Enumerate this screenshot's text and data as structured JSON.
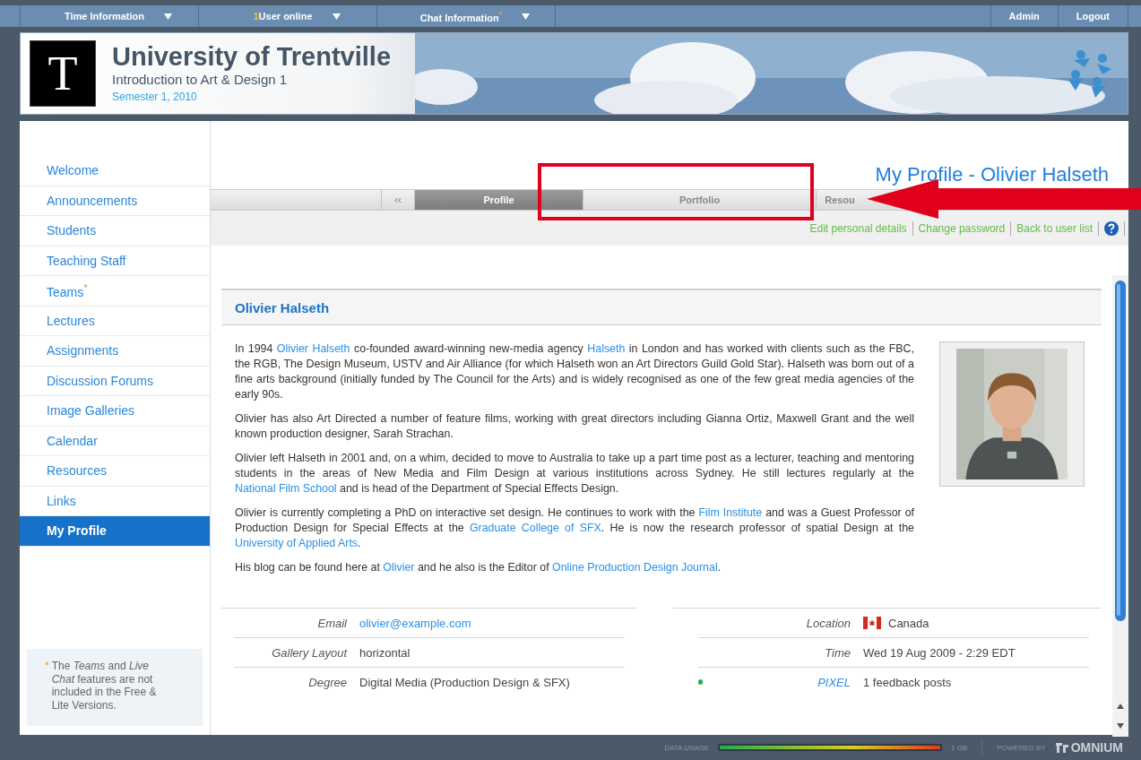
{
  "top_bar": {
    "menus": [
      {
        "label": "Time Information"
      },
      {
        "count": "1",
        "label": "User online"
      },
      {
        "label": "Chat Information",
        "mark": "*"
      }
    ],
    "buttons": [
      "Admin",
      "Logout"
    ]
  },
  "header": {
    "logo_letter": "T",
    "title": "University of Trentville",
    "subtitle": "Introduction to Art & Design 1",
    "semester": "Semester 1, 2010"
  },
  "sidebar": {
    "items": [
      {
        "label": "Welcome",
        "selected": false
      },
      {
        "label": "Announcements",
        "selected": false
      },
      {
        "label": "Students",
        "selected": false
      },
      {
        "label": "Teaching Staff",
        "selected": false
      },
      {
        "label": "Teams",
        "mark": "*",
        "selected": false
      },
      {
        "label": "Lectures",
        "selected": false
      },
      {
        "label": "Assignments",
        "selected": false
      },
      {
        "label": "Discussion Forums",
        "selected": false
      },
      {
        "label": "Image Galleries",
        "selected": false
      },
      {
        "label": "Calendar",
        "selected": false
      },
      {
        "label": "Resources",
        "selected": false
      },
      {
        "label": "Links",
        "selected": false
      },
      {
        "label": "My Profile",
        "selected": true
      }
    ],
    "note": {
      "mark": "*",
      "text": "The *Teams* and *Live Chat* features are not included in the Free & Lite Versions."
    }
  },
  "page_title": "My Profile - Olivier Halseth",
  "tabs": {
    "previous": "‹‹",
    "items": [
      {
        "label": "Profile",
        "selected": true
      },
      {
        "label": "Portfolio",
        "selected": false
      },
      {
        "label": "Resou",
        "selected": false
      }
    ]
  },
  "actions": [
    "Edit personal details",
    "Change password",
    "Back to user list"
  ],
  "profile": {
    "name": "Olivier Halseth",
    "paragraphs": [
      [
        {
          "text": "In 1994 ",
          "kind": "text"
        },
        {
          "text": "Olivier Halseth",
          "kind": "link"
        },
        {
          "text": " co-founded award-winning new-media agency ",
          "kind": "text"
        },
        {
          "text": "Halseth",
          "kind": "link"
        },
        {
          "text": " in London and has worked with clients such as the FBC, the RGB, The Design Museum, USTV and Air Alliance (for which Halseth won an Art Directors Guild Gold Star). Halseth was born out of a fine arts background (initially funded by The Council for the Arts) and is widely recognised as one of the few great media agencies of the early 90s.",
          "kind": "text"
        }
      ],
      [
        {
          "text": "Olivier has also Art Directed a number of feature films, working with great directors including Gianna Ortiz, Maxwell Grant and the well known production designer, Sarah Strachan.",
          "kind": "text"
        }
      ],
      [
        {
          "text": "Olivier left Halseth in 2001 and, on a whim, decided to move to Australia to take up a part time post as a lecturer, teaching and mentoring students in the areas of New Media and Film Design at various institutions across Sydney. He still lectures regularly at the ",
          "kind": "text"
        },
        {
          "text": "National Film School",
          "kind": "link"
        },
        {
          "text": " and is head of the Department of Special Effects Design.",
          "kind": "text"
        }
      ],
      [
        {
          "text": "Olivier is currently completing a PhD on interactive set design. He continues to work with the ",
          "kind": "text"
        },
        {
          "text": "Film Institute",
          "kind": "link"
        },
        {
          "text": " and was a Guest Professor of Production Design for Special Effects at the ",
          "kind": "text"
        },
        {
          "text": "Graduate College of SFX",
          "kind": "link"
        },
        {
          "text": ". He is now the research professor of spatial Design at the ",
          "kind": "text"
        },
        {
          "text": "University of Applied Arts",
          "kind": "link"
        },
        {
          "text": ".",
          "kind": "text"
        }
      ],
      [
        {
          "text": "His blog can be found here at ",
          "kind": "text"
        },
        {
          "text": "Olivier",
          "kind": "link"
        },
        {
          "text": " and he also is the Editor of ",
          "kind": "text"
        },
        {
          "text": "Online Production Design Journal",
          "kind": "link"
        },
        {
          "text": ".",
          "kind": "text"
        }
      ]
    ],
    "photo": {
      "kind": "picture"
    },
    "fields_left": [
      {
        "label": "Email",
        "value": "olivier@example.com",
        "kind": "link"
      },
      {
        "label": "Gallery Layout",
        "value": "horizontal",
        "kind": "text"
      },
      {
        "label": "Degree",
        "value": "Digital Media (Production Design & SFX)",
        "kind": "text"
      }
    ],
    "fields_right": [
      {
        "label": "Location",
        "value": "Canada",
        "kind": "flag"
      },
      {
        "label": "Time",
        "value": "Wed 19 Aug 2009 - 2:29 EDT",
        "kind": "text"
      },
      {
        "label": "PIXEL",
        "value": "1 feedback posts",
        "kind": "status",
        "color": "#22b14c"
      }
    ]
  },
  "footer": {
    "usage_label": "DATA USAGE",
    "usage": {
      "level": 1
    },
    "usage_value": "1 GB",
    "powered_by": "POWERED BY",
    "brand": "OMNIUM"
  }
}
